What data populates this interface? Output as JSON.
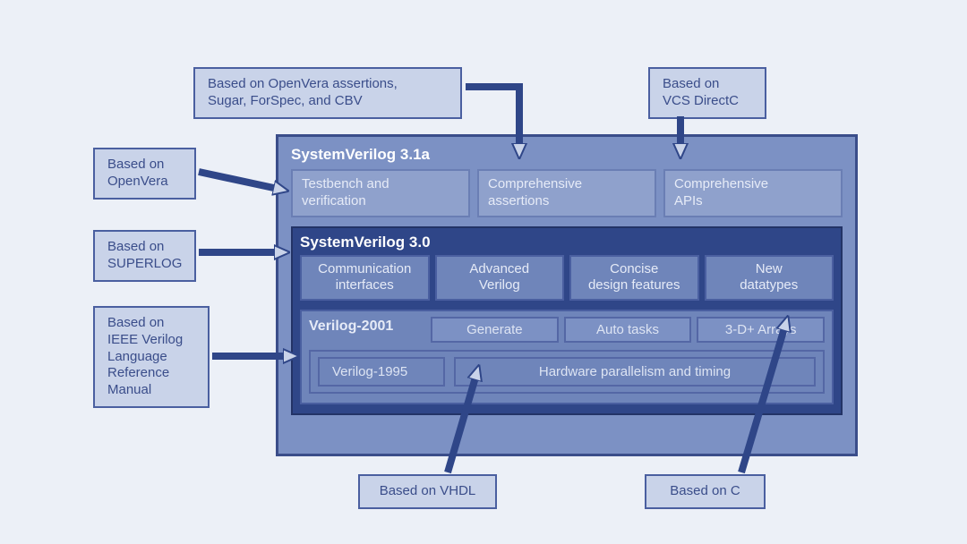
{
  "callouts": {
    "openvera_assert": "Based on OpenVera  assertions,\nSugar, ForSpec, and CBV",
    "vcs_directc": "Based on\nVCS  DirectC",
    "openvera": "Based on\nOpenVera",
    "superlog": "Based on\nSUPERLOG",
    "ieee": "Based on\nIEEE Verilog\nLanguage\nReference\nManual",
    "vhdl": "Based on VHDL",
    "c": "Based on C"
  },
  "sv31a": {
    "title": "SystemVerilog 3.1a",
    "features": {
      "tb": "Testbench and\nverification",
      "assert": "Comprehensive\nassertions",
      "apis": "Comprehensive\nAPIs"
    }
  },
  "sv30": {
    "title": "SystemVerilog 3.0",
    "features": {
      "comm": "Communication\ninterfaces",
      "adv": "Advanced\nVerilog",
      "concise": "Concise\ndesign features",
      "dt": "New\ndatatypes"
    }
  },
  "v2001": {
    "title": "Verilog-2001",
    "features": {
      "gen": "Generate",
      "auto": "Auto tasks",
      "arr": "3-D+ Arrays"
    }
  },
  "v1995": {
    "title": "Verilog-1995",
    "feature": "Hardware parallelism and timing"
  }
}
